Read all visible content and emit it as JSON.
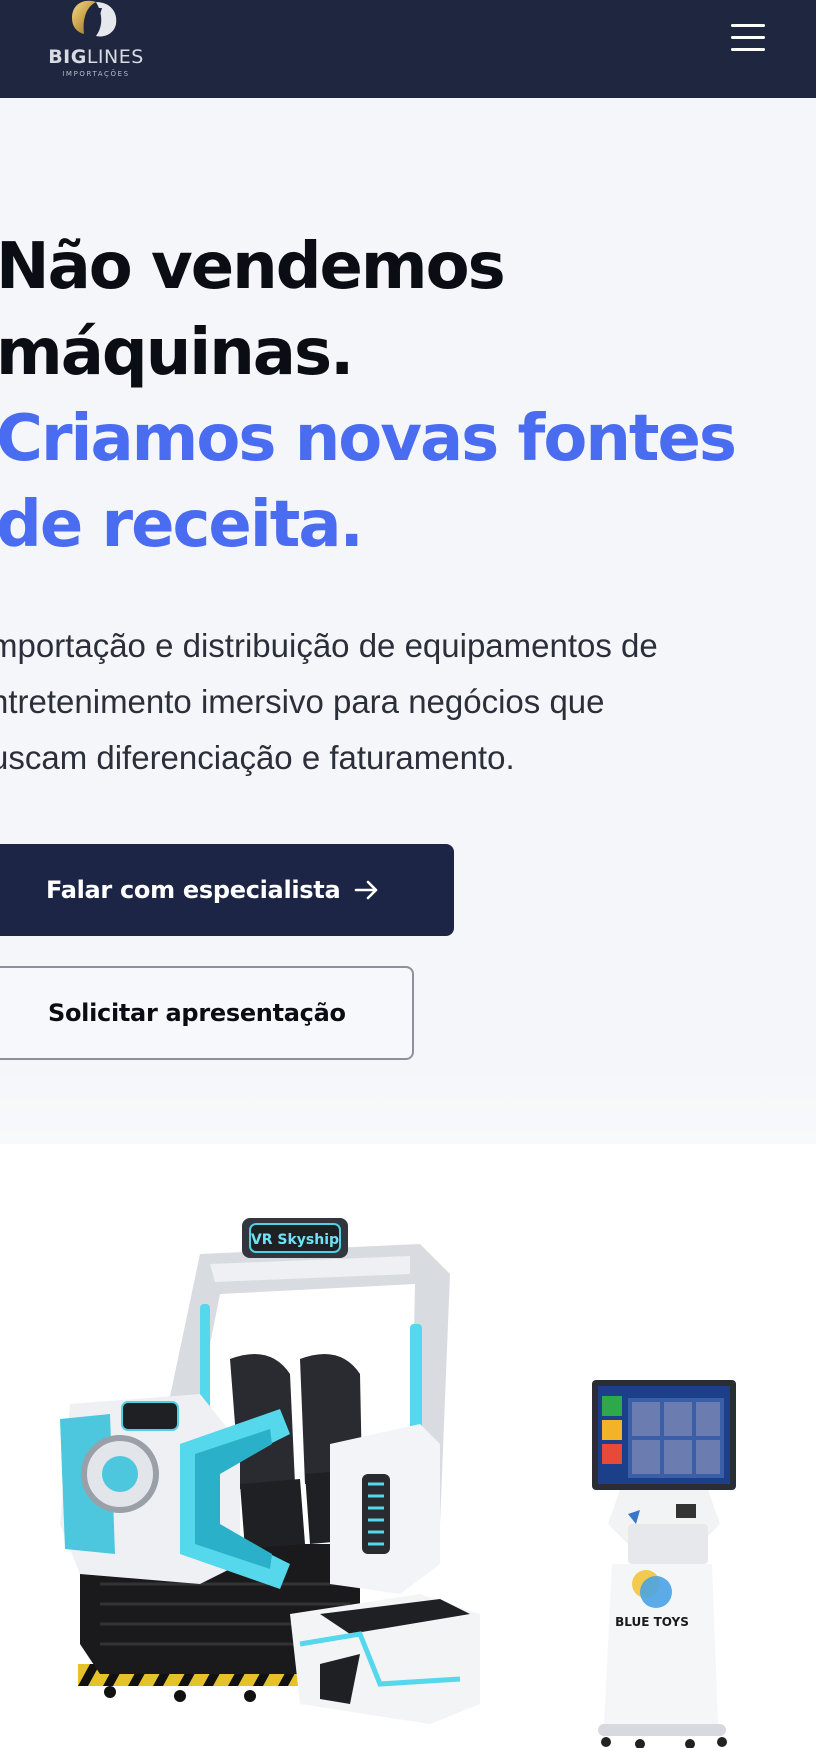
{
  "header": {
    "logo_text_bold": "BIG",
    "logo_text_light": "LINES",
    "logo_subtitle": "IMPORTAÇÕES",
    "menu_icon": "hamburger-menu-icon",
    "background": "#1f2740"
  },
  "hero": {
    "headline_line1": "Não vendemos",
    "headline_line2": "máquinas.",
    "highlight_line1": "Criamos novas fontes",
    "highlight_line2": "de receita.",
    "description_line1": "mportação e distribuição de equipamentos de",
    "description_line2": "ntretenimento imersivo para negócios que",
    "description_line3": "uscam diferenciação e faturamento.",
    "accent_color": "#4a6cf0"
  },
  "buttons": {
    "primary_label": "Falar com especialista",
    "primary_icon": "arrow-right-icon",
    "secondary_label": "Solicitar apresentação"
  },
  "products": {
    "vr_sign_text": "VR Skyship",
    "kiosk_brand_text": "BLUE TOYS"
  }
}
